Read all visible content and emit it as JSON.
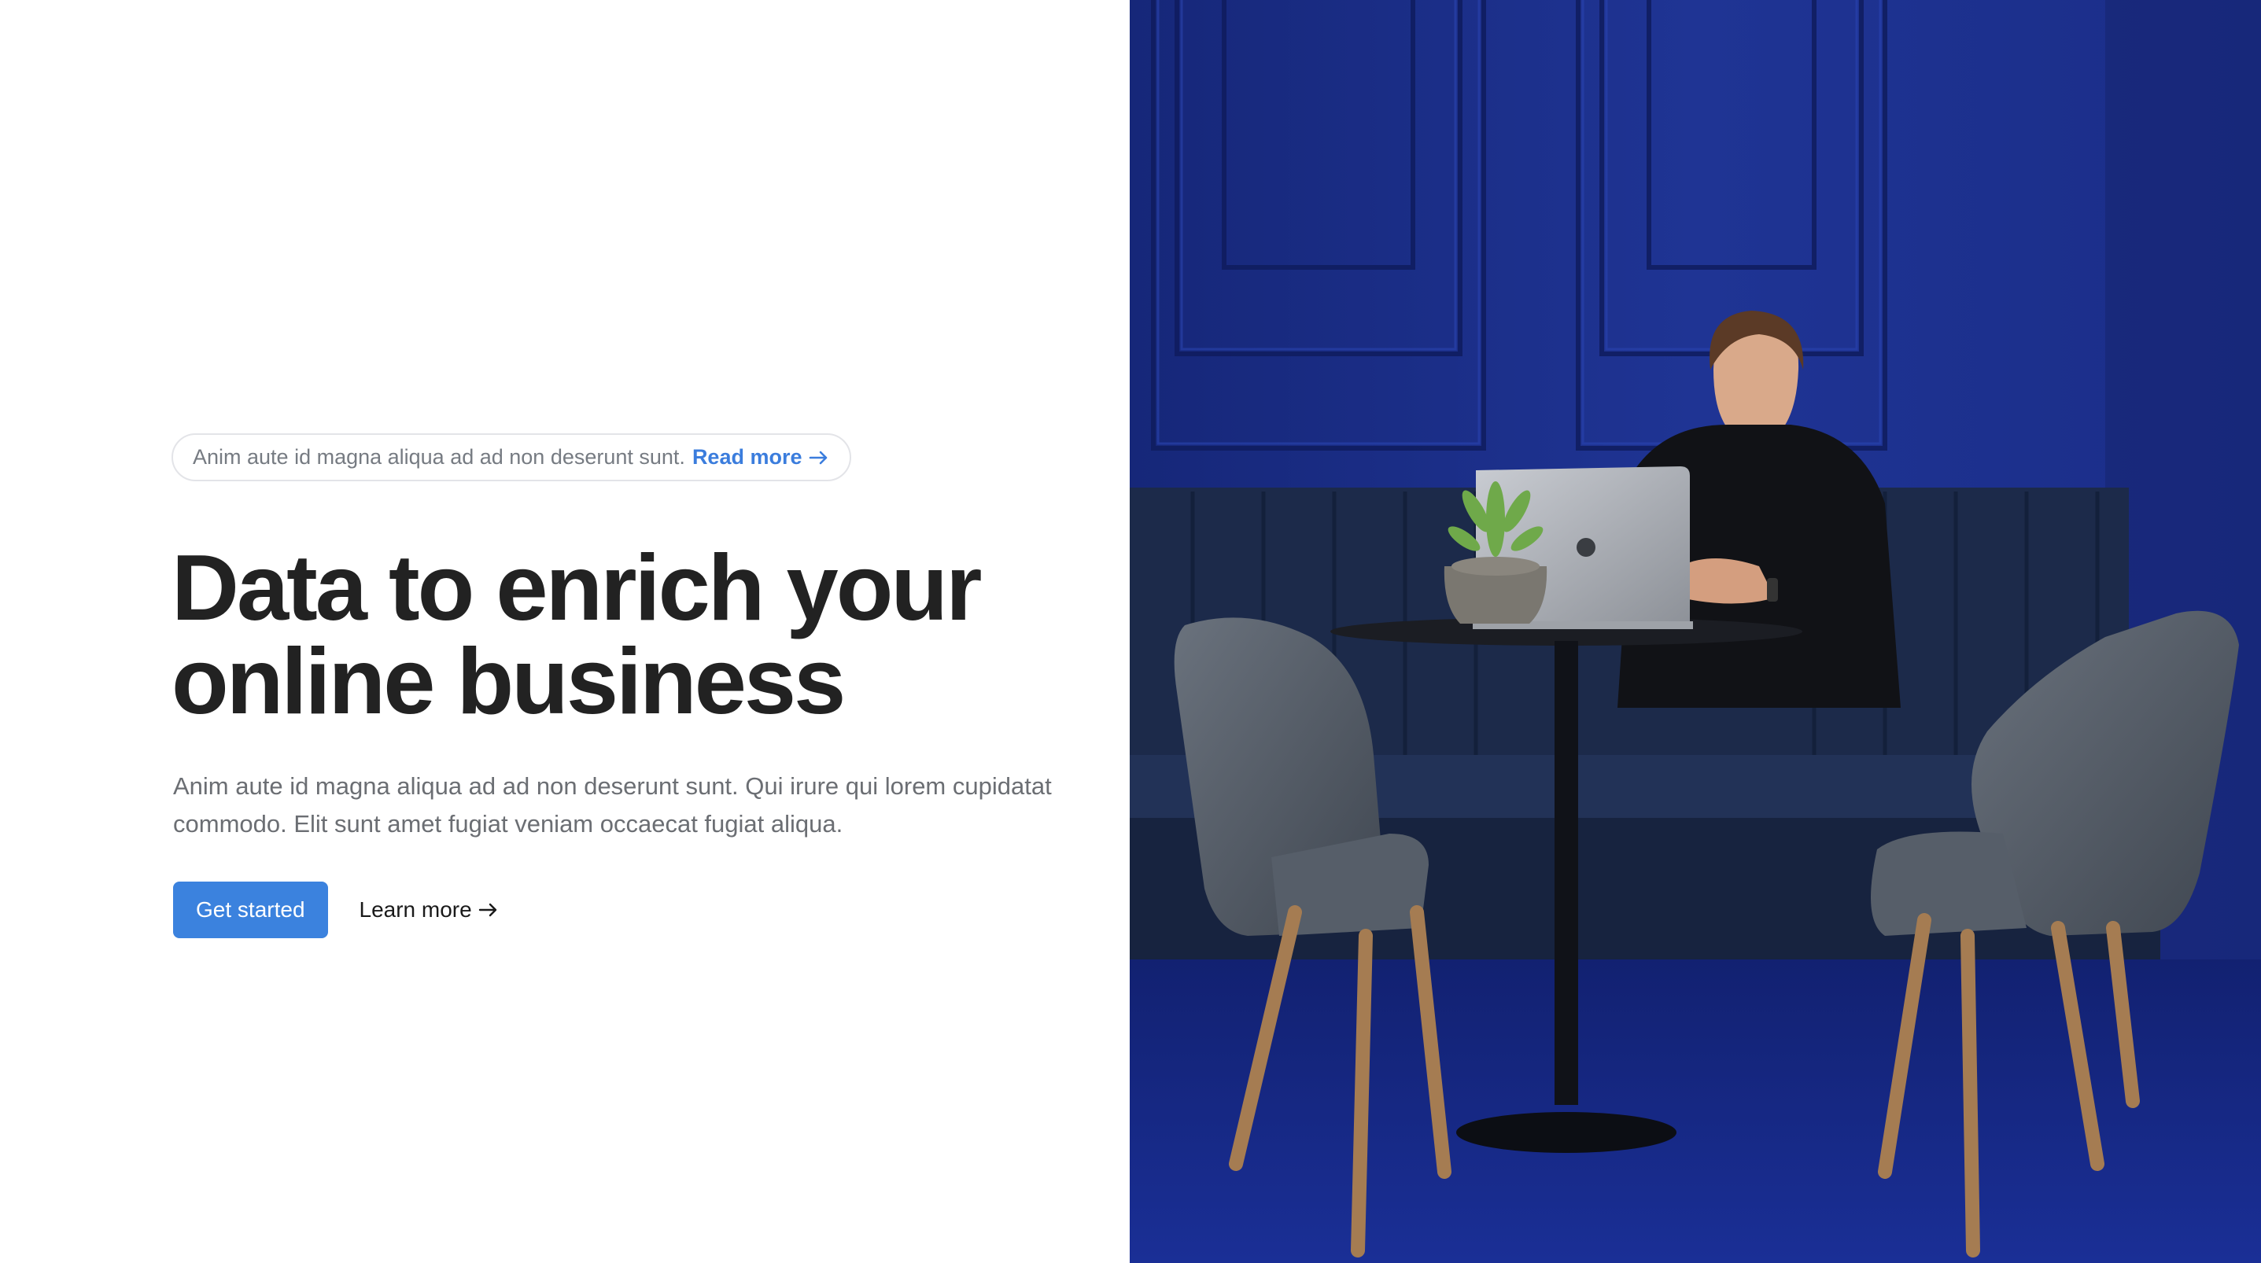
{
  "announcement": {
    "text": "Anim aute id magna aliqua ad ad non deserunt sunt.",
    "link_label": "Read more",
    "link_icon": "arrow-right-icon"
  },
  "hero": {
    "title_line1": "Data to enrich your",
    "title_line2": "online business",
    "subtitle": "Anim aute id magna aliqua ad ad non deserunt sunt. Qui irure qui lorem cupidatat commodo. Elit sunt amet fugiat veniam occaecat fugiat aliqua.",
    "primary_cta": "Get started",
    "secondary_cta": "Learn more",
    "secondary_icon": "arrow-right-icon"
  },
  "image": {
    "alt": "photo: man working on a laptop at a small round table in a blue room with two grey armchairs"
  },
  "colors": {
    "accent": "#3b82de",
    "link": "#3b7ddd",
    "heading": "#222222",
    "body_text": "#6b6e73",
    "photo_wall": "#1c2f8c"
  }
}
